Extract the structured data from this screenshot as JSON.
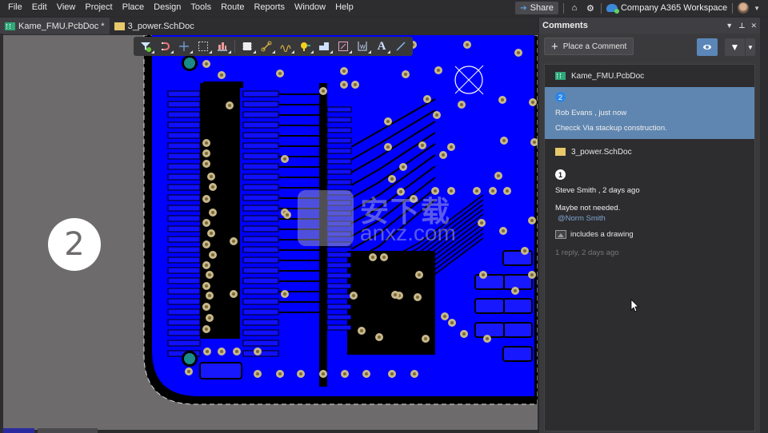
{
  "menu": [
    "File",
    "Edit",
    "View",
    "Project",
    "Place",
    "Design",
    "Tools",
    "Route",
    "Reports",
    "Window",
    "Help"
  ],
  "topbar": {
    "share_label": "Share",
    "workspace_label": "Company A365 Workspace"
  },
  "document_tabs": [
    {
      "label": "Kame_FMU.PcbDoc *",
      "type": "pcb",
      "active": true
    },
    {
      "label": "3_power.SchDoc",
      "type": "sch",
      "active": false
    }
  ],
  "toolbar": {
    "tools": [
      "filter",
      "interactive-routing-magnet",
      "place-cross",
      "select-rectangle",
      "place-component",
      "place-fill",
      "interactive-routing",
      "diff-pair-routing",
      "place-via",
      "place-polygon",
      "place-region",
      "place-string-area",
      "place-text",
      "place-line"
    ]
  },
  "canvas": {
    "step_number": "2",
    "colors": {
      "board_fill": "#0000ff",
      "background": "#6d6b6b",
      "via": "#c8b88a",
      "via_hole": "#7a6a3a",
      "highlight_via": "#1a8a8a"
    }
  },
  "comments_panel": {
    "title": "Comments",
    "place_comment_label": "Place a Comment",
    "groups": [
      {
        "file": "Kame_FMU.PcbDoc",
        "file_type": "pcb",
        "comments": [
          {
            "number": "2",
            "author_line": "Rob Evans , just now",
            "text": "Checck Via stackup construction.",
            "selected": true
          }
        ]
      },
      {
        "file": "3_power.SchDoc",
        "file_type": "sch",
        "comments": [
          {
            "number": "1",
            "author_line": "Steve Smith , 2 days ago",
            "text": "Maybe not needed.",
            "mention": "@Norm Smith",
            "attachment": "includes a drawing",
            "reply_meta": "1 reply, 2 days ago",
            "selected": false
          }
        ]
      }
    ]
  },
  "watermark": {
    "text": "安下载",
    "url": "anxz.com"
  }
}
